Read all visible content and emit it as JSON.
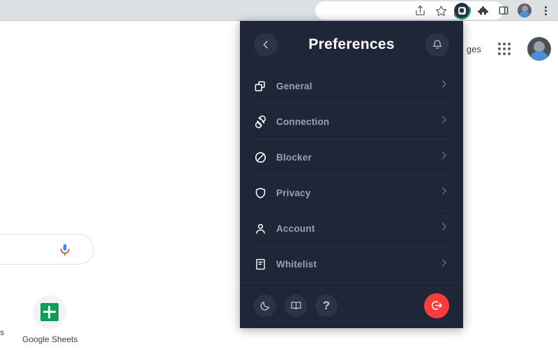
{
  "browser": {
    "toolbar_buttons": [
      {
        "name": "share-icon",
        "label": "Share"
      },
      {
        "name": "bookmark-star-icon",
        "label": "Bookmark this tab"
      },
      {
        "name": "extension-active-icon",
        "label": "Extension"
      },
      {
        "name": "extensions-puzzle-icon",
        "label": "Extensions"
      },
      {
        "name": "side-panel-icon",
        "label": "Side panel"
      },
      {
        "name": "profile-avatar",
        "label": "Profile"
      },
      {
        "name": "chrome-menu-icon",
        "label": "Customize and control Google Chrome"
      }
    ]
  },
  "page": {
    "nav_link": "ges",
    "apps_label": "Google apps",
    "avatar_label": "Google Account",
    "search_placeholder": "",
    "mic_label": "Search by voice",
    "shortcut": {
      "label": "Google Sheets",
      "cut_label": "s"
    }
  },
  "panel": {
    "title": "Preferences",
    "back_label": "Back",
    "bell_label": "Notifications",
    "colors": {
      "background": "#1e2637",
      "divider": "#2a3245",
      "label": "#9aa2b2",
      "accent_logout": "#f93c3c",
      "circle_button": "#2b3447"
    },
    "items": [
      {
        "label": "General",
        "icon": "windows-icon",
        "chevron": "chevron-right-icon"
      },
      {
        "label": "Connection",
        "icon": "plug-icon",
        "chevron": "chevron-right-icon"
      },
      {
        "label": "Blocker",
        "icon": "block-icon",
        "chevron": "chevron-right-icon"
      },
      {
        "label": "Privacy",
        "icon": "shield-icon",
        "chevron": "chevron-right-icon"
      },
      {
        "label": "Account",
        "icon": "user-icon",
        "chevron": "chevron-right-icon"
      },
      {
        "label": "Whitelist",
        "icon": "document-icon",
        "chevron": "chevron-right-icon"
      }
    ],
    "footer": {
      "dark_mode_label": "Dark mode",
      "docs_label": "Documentation",
      "help_label": "?",
      "logout_label": "Log out"
    }
  }
}
